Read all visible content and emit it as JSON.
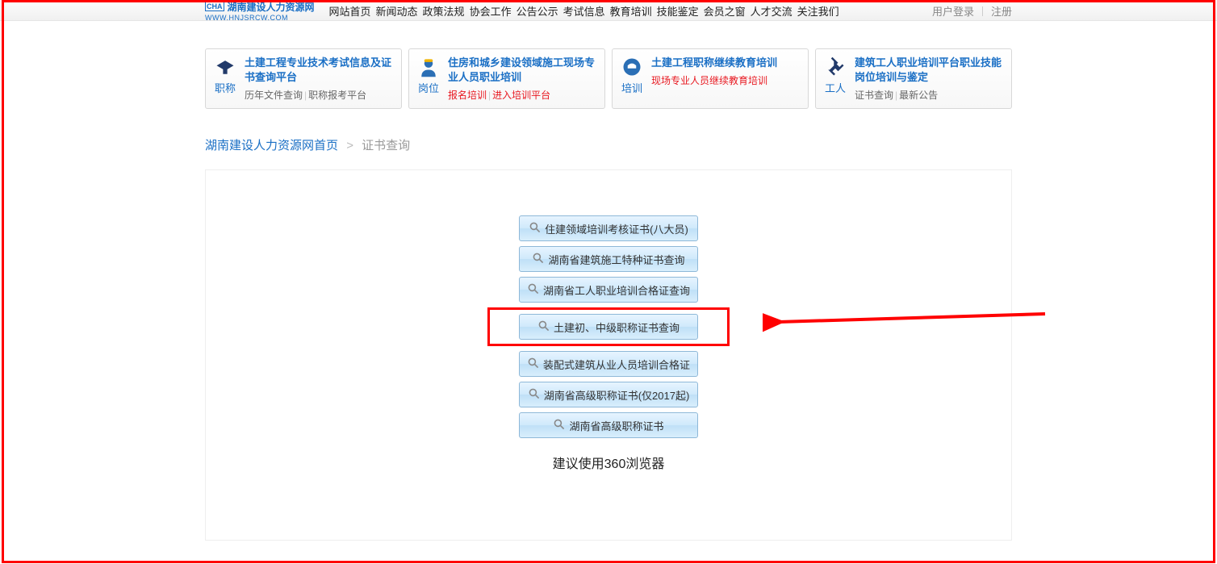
{
  "header": {
    "logo_text": "湖南建设人力资源网",
    "logo_badge": "CHA",
    "logo_url": "WWW.HNJSRCW.COM",
    "nav": [
      "网站首页",
      "新闻动态",
      "政策法规",
      "协会工作",
      "公告公示",
      "考试信息",
      "教育培训",
      "技能鉴定",
      "会员之窗",
      "人才交流",
      "关注我们"
    ],
    "auth_login": "用户登录",
    "auth_register": "注册"
  },
  "cards": [
    {
      "icon_label": "职称",
      "title": "土建工程专业技术考试信息及证书查询平台",
      "links": [
        {
          "text": "历年文件查询",
          "red": false
        },
        {
          "text": "职称报考平台",
          "red": false
        }
      ]
    },
    {
      "icon_label": "岗位",
      "title": "住房和城乡建设领域施工现场专业人员职业培训",
      "links": [
        {
          "text": "报名培训",
          "red": true
        },
        {
          "text": "进入培训平台",
          "red": true
        }
      ]
    },
    {
      "icon_label": "培训",
      "title": "土建工程职称继续教育培训",
      "links": [
        {
          "text": "现场专业人员继续教育培训",
          "red": true
        }
      ]
    },
    {
      "icon_label": "工人",
      "title": "建筑工人职业培训平台职业技能岗位培训与鉴定",
      "links": [
        {
          "text": "证书查询",
          "red": false
        },
        {
          "text": "最新公告",
          "red": false
        }
      ]
    }
  ],
  "breadcrumb": {
    "home": "湖南建设人力资源网首页",
    "current": "证书查询"
  },
  "query_buttons": [
    {
      "label": "住建领域培训考核证书(八大员)",
      "highlight": false
    },
    {
      "label": "湖南省建筑施工特种证书查询",
      "highlight": false
    },
    {
      "label": "湖南省工人职业培训合格证查询",
      "highlight": false
    },
    {
      "label": "土建初、中级职称证书查询",
      "highlight": true
    },
    {
      "label": "装配式建筑从业人员培训合格证",
      "highlight": false
    },
    {
      "label": "湖南省高级职称证书(仅2017起)",
      "highlight": false
    },
    {
      "label": "湖南省高级职称证书",
      "highlight": false
    }
  ],
  "hint": "建议使用360浏览器"
}
